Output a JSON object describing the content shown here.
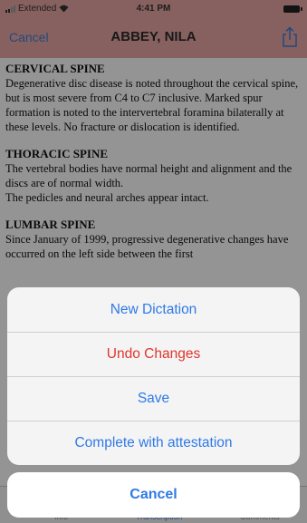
{
  "status_bar": {
    "carrier": "Extended",
    "time": "4:41 PM"
  },
  "nav": {
    "cancel_label": "Cancel",
    "title": "ABBEY, NILA",
    "share_icon": "share-icon"
  },
  "document": {
    "sections": [
      {
        "title": "CERVICAL SPINE",
        "body": "Degenerative disc disease is noted throughout the cervical spine, but is most severe from C4 to C7 inclusive. Marked spur formation is noted to the intervertebral foramina bilaterally at these levels. No fracture or dislocation is identified."
      },
      {
        "title": "THORACIC SPINE",
        "body": "The vertebral bodies have normal height and alignment and the discs are of normal width.\nThe pedicles and neural arches appear intact."
      },
      {
        "title": "LUMBAR SPINE",
        "body": "Since January of 1999, progressive degenerative changes have occurred on the left side between the first"
      }
    ]
  },
  "tabs": {
    "info": "Info",
    "transcription": "Transcription",
    "comments": "Comments"
  },
  "action_sheet": {
    "actions": [
      {
        "label": "New Dictation"
      },
      {
        "label": "Undo Changes"
      },
      {
        "label": "Save"
      },
      {
        "label": "Complete with attestation"
      }
    ],
    "cancel_label": "Cancel"
  },
  "colors": {
    "header_bg": "#e8a8a6",
    "action_blue": "#2f7ae5",
    "destructive_red": "#e0352b"
  }
}
